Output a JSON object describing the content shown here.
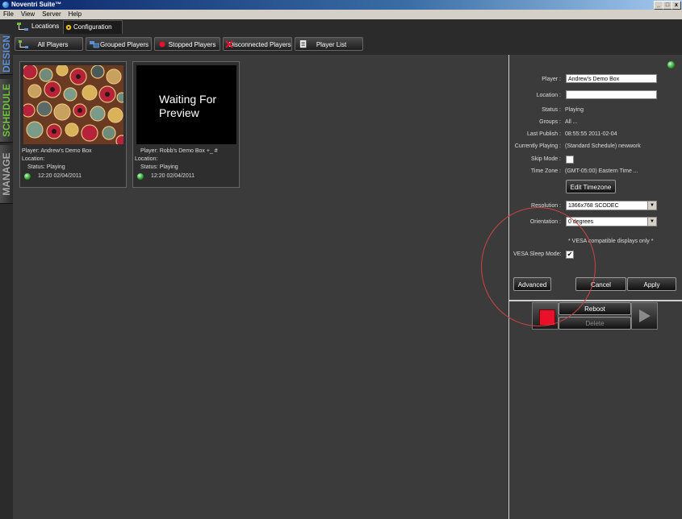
{
  "window": {
    "title": "Noventri Suite™",
    "controls": [
      "_",
      "□",
      "x"
    ]
  },
  "menu": [
    "File",
    "View",
    "Server",
    "Help"
  ],
  "top_tabs": [
    {
      "label": "Locations",
      "active": false
    },
    {
      "label": "Configuration",
      "active": true
    }
  ],
  "side_nav": [
    {
      "label": "DESIGN",
      "color": "#5b8fd6"
    },
    {
      "label": "SCHEDULE",
      "color": "#6fc23a"
    },
    {
      "label": "MANAGE",
      "color": "#a8a8a8"
    }
  ],
  "toolbar": [
    {
      "label": "All Players",
      "icon": "network-icon"
    },
    {
      "label": "Grouped Players",
      "icon": "monitors-icon"
    },
    {
      "label": "Stopped Players",
      "icon": "red-dot-icon"
    },
    {
      "label": "Disconnected Players",
      "icon": "red-x-icon"
    },
    {
      "label": "Player List",
      "icon": "list-icon"
    }
  ],
  "players": [
    {
      "thumb": "pattern",
      "player": "Player:  Andrew's Demo Box",
      "location": "Location:",
      "status": "Status:   Playing",
      "time": "12:20 02/04/2011"
    },
    {
      "thumb": "waiting",
      "waiting_text": "Waiting For Preview",
      "player": "Player:  Robb's Demo Box +_ #",
      "location": "Location:",
      "status": "Status:   Playing",
      "time": "12:20 02/04/2011"
    }
  ],
  "details": {
    "player_label": "Player :",
    "player_value": "Andrew's Demo Box",
    "location_label": "Location :",
    "location_value": "",
    "status_label": "Status :",
    "status_value": "Playing",
    "groups_label": "Groups :",
    "groups_value": "All  ...",
    "last_publish_label": "Last Publish :",
    "last_publish_value": "08:55:55 2011-02-04",
    "currently_playing_label": "Currently Playing :",
    "currently_playing_value": "(Standard Schedule) newwork",
    "skip_mode_label": "Skip Mode :",
    "skip_mode_checked": false,
    "time_zone_label": "Time Zone :",
    "time_zone_value": "(GMT-05:00) Eastern Time  ...",
    "edit_timezone_button": "Edit Timezone",
    "resolution_label": "Resolution :",
    "resolution_value": "1366x768 SCODEC",
    "orientation_label": "Orientation :",
    "orientation_value": "0 degrees",
    "vesa_note": "* VESA compatible displays only *",
    "vesa_sleep_label": "VESA Sleep Mode:",
    "vesa_sleep_checked": true,
    "advanced_button": "Advanced",
    "cancel_button": "Cancel",
    "apply_button": "Apply"
  },
  "control": {
    "reboot_button": "Reboot",
    "delete_button": "Delete"
  },
  "colors": {
    "status_green": "#2a9a2a",
    "stop_red": "#e8102a",
    "annotation_ring": "#cc4444"
  }
}
